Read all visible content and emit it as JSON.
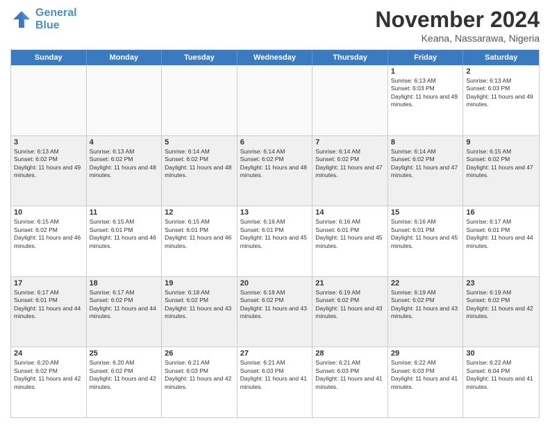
{
  "logo": {
    "line1": "General",
    "line2": "Blue"
  },
  "title": "November 2024",
  "location": "Keana, Nassarawa, Nigeria",
  "days_of_week": [
    "Sunday",
    "Monday",
    "Tuesday",
    "Wednesday",
    "Thursday",
    "Friday",
    "Saturday"
  ],
  "weeks": [
    [
      {
        "day": "",
        "info": ""
      },
      {
        "day": "",
        "info": ""
      },
      {
        "day": "",
        "info": ""
      },
      {
        "day": "",
        "info": ""
      },
      {
        "day": "",
        "info": ""
      },
      {
        "day": "1",
        "info": "Sunrise: 6:13 AM\nSunset: 6:03 PM\nDaylight: 11 hours and 49 minutes."
      },
      {
        "day": "2",
        "info": "Sunrise: 6:13 AM\nSunset: 6:03 PM\nDaylight: 11 hours and 49 minutes."
      }
    ],
    [
      {
        "day": "3",
        "info": "Sunrise: 6:13 AM\nSunset: 6:02 PM\nDaylight: 11 hours and 49 minutes."
      },
      {
        "day": "4",
        "info": "Sunrise: 6:13 AM\nSunset: 6:02 PM\nDaylight: 11 hours and 48 minutes."
      },
      {
        "day": "5",
        "info": "Sunrise: 6:14 AM\nSunset: 6:02 PM\nDaylight: 11 hours and 48 minutes."
      },
      {
        "day": "6",
        "info": "Sunrise: 6:14 AM\nSunset: 6:02 PM\nDaylight: 11 hours and 48 minutes."
      },
      {
        "day": "7",
        "info": "Sunrise: 6:14 AM\nSunset: 6:02 PM\nDaylight: 11 hours and 47 minutes."
      },
      {
        "day": "8",
        "info": "Sunrise: 6:14 AM\nSunset: 6:02 PM\nDaylight: 11 hours and 47 minutes."
      },
      {
        "day": "9",
        "info": "Sunrise: 6:15 AM\nSunset: 6:02 PM\nDaylight: 11 hours and 47 minutes."
      }
    ],
    [
      {
        "day": "10",
        "info": "Sunrise: 6:15 AM\nSunset: 6:02 PM\nDaylight: 11 hours and 46 minutes."
      },
      {
        "day": "11",
        "info": "Sunrise: 6:15 AM\nSunset: 6:01 PM\nDaylight: 11 hours and 46 minutes."
      },
      {
        "day": "12",
        "info": "Sunrise: 6:15 AM\nSunset: 6:01 PM\nDaylight: 11 hours and 46 minutes."
      },
      {
        "day": "13",
        "info": "Sunrise: 6:16 AM\nSunset: 6:01 PM\nDaylight: 11 hours and 45 minutes."
      },
      {
        "day": "14",
        "info": "Sunrise: 6:16 AM\nSunset: 6:01 PM\nDaylight: 11 hours and 45 minutes."
      },
      {
        "day": "15",
        "info": "Sunrise: 6:16 AM\nSunset: 6:01 PM\nDaylight: 11 hours and 45 minutes."
      },
      {
        "day": "16",
        "info": "Sunrise: 6:17 AM\nSunset: 6:01 PM\nDaylight: 11 hours and 44 minutes."
      }
    ],
    [
      {
        "day": "17",
        "info": "Sunrise: 6:17 AM\nSunset: 6:01 PM\nDaylight: 11 hours and 44 minutes."
      },
      {
        "day": "18",
        "info": "Sunrise: 6:17 AM\nSunset: 6:02 PM\nDaylight: 11 hours and 44 minutes."
      },
      {
        "day": "19",
        "info": "Sunrise: 6:18 AM\nSunset: 6:02 PM\nDaylight: 11 hours and 43 minutes."
      },
      {
        "day": "20",
        "info": "Sunrise: 6:18 AM\nSunset: 6:02 PM\nDaylight: 11 hours and 43 minutes."
      },
      {
        "day": "21",
        "info": "Sunrise: 6:19 AM\nSunset: 6:02 PM\nDaylight: 11 hours and 43 minutes."
      },
      {
        "day": "22",
        "info": "Sunrise: 6:19 AM\nSunset: 6:02 PM\nDaylight: 11 hours and 43 minutes."
      },
      {
        "day": "23",
        "info": "Sunrise: 6:19 AM\nSunset: 6:02 PM\nDaylight: 11 hours and 42 minutes."
      }
    ],
    [
      {
        "day": "24",
        "info": "Sunrise: 6:20 AM\nSunset: 6:02 PM\nDaylight: 11 hours and 42 minutes."
      },
      {
        "day": "25",
        "info": "Sunrise: 6:20 AM\nSunset: 6:02 PM\nDaylight: 11 hours and 42 minutes."
      },
      {
        "day": "26",
        "info": "Sunrise: 6:21 AM\nSunset: 6:03 PM\nDaylight: 11 hours and 42 minutes."
      },
      {
        "day": "27",
        "info": "Sunrise: 6:21 AM\nSunset: 6:03 PM\nDaylight: 11 hours and 41 minutes."
      },
      {
        "day": "28",
        "info": "Sunrise: 6:21 AM\nSunset: 6:03 PM\nDaylight: 11 hours and 41 minutes."
      },
      {
        "day": "29",
        "info": "Sunrise: 6:22 AM\nSunset: 6:03 PM\nDaylight: 11 hours and 41 minutes."
      },
      {
        "day": "30",
        "info": "Sunrise: 6:22 AM\nSunset: 6:04 PM\nDaylight: 11 hours and 41 minutes."
      }
    ]
  ]
}
